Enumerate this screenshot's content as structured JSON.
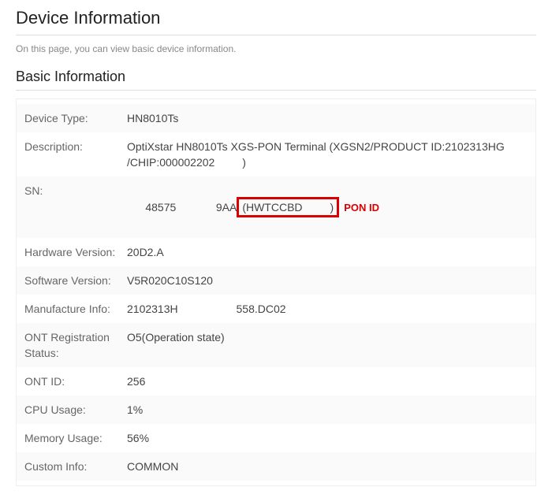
{
  "page": {
    "title": "Device Information",
    "description": "On this page, you can view basic device information."
  },
  "section": {
    "title": "Basic Information"
  },
  "rows": {
    "device_type": {
      "label": "Device Type:",
      "value": "HN8010Ts"
    },
    "description": {
      "label": "Description:",
      "value": "OptiXstar HN8010Ts XGS-PON Terminal (XGSN2/PRODUCT ID:2102313HG                    /CHIP:000002202         )"
    },
    "sn": {
      "label": "SN:",
      "prefix": "48575             9AA",
      "highlight": "(HWTCCBD         )",
      "annot": "PON ID"
    },
    "hardware_version": {
      "label": "Hardware Version:",
      "value": "20D2.A"
    },
    "software_version": {
      "label": "Software Version:",
      "value": "V5R020C10S120"
    },
    "manufacture_info": {
      "label": "Manufacture Info:",
      "value": "2102313H                   558.DC02"
    },
    "ont_reg_status": {
      "label": "ONT Registration Status:",
      "value": "O5(Operation state)"
    },
    "ont_id": {
      "label": "ONT ID:",
      "value": "256"
    },
    "cpu_usage": {
      "label": "CPU Usage:",
      "value": "1%"
    },
    "memory_usage": {
      "label": "Memory Usage:",
      "value": "56%"
    },
    "custom_info": {
      "label": "Custom Info:",
      "value": "COMMON"
    }
  }
}
